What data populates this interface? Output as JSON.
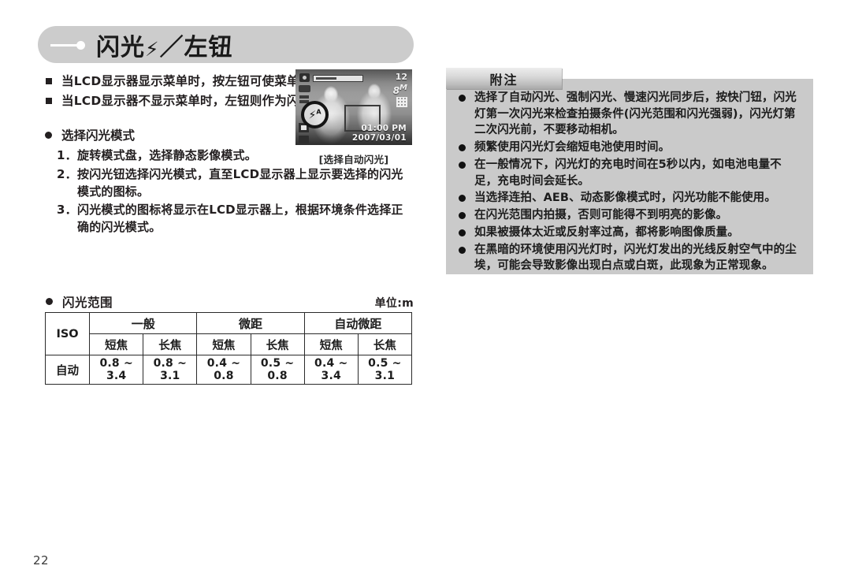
{
  "header": {
    "title_prefix": "闪光",
    "bolt_icon": "⚡",
    "title_suffix": "／左钮",
    "full_title": "闪光⚡ ／左钮"
  },
  "left_column": {
    "square_bullets": [
      "当LCD显示器显示菜单时，按左钮可使菜单光标左移。",
      "当LCD显示器不显示菜单时，左钮则作为闪光钮 ⚡ 使用。"
    ],
    "section_heading": "选择闪光模式",
    "steps": [
      {
        "num": "1．",
        "text": "旋转模式盘，选择静态影像模式。"
      },
      {
        "num": "2．",
        "text": "按闪光钮选择闪光模式，直至LCD显示器上显示要选择的闪光模式的图标。"
      },
      {
        "num": "3．",
        "text": "闪光模式的图标将显示在LCD显示器上，根据环境条件选择正确的闪光模式。"
      }
    ]
  },
  "lcd_figure": {
    "shots_remaining": "12",
    "resolution": "8",
    "resolution_suffix": "M",
    "time": "01:00 PM",
    "date": "2007/03/01",
    "flash_icon_label": "A",
    "caption": "[选择自动闪光]"
  },
  "notes": {
    "tab_label": "附注",
    "items": [
      "选择了自动闪光、强制闪光、慢速闪光同步后，按快门钮，闪光灯第一次闪光来检查拍摄条件(闪光范围和闪光强弱)，闪光灯第二次闪光前，不要移动相机。",
      "频繁使用闪光灯会缩短电池使用时间。",
      "在一般情况下，闪光灯的充电时间在5秒以内，如电池电量不足，充电时间会延长。",
      "当选择连拍、AEB、动态影像模式时，闪光功能不能使用。",
      "在闪光范围内拍摄，否则可能得不到明亮的影像。",
      "如果被摄体太近或反射率过高，都将影响图像质量。",
      "在黑暗的环境使用闪光灯时，闪光灯发出的光线反射空气中的尘埃，可能会导致影像出现白点或白斑，此现象为正常现象。"
    ]
  },
  "flash_range": {
    "heading": "闪光范围",
    "unit_label": "单位:m",
    "iso_label": "ISO",
    "groups": [
      "一般",
      "微距",
      "自动微距"
    ],
    "sub_headers": [
      "短焦",
      "长焦",
      "短焦",
      "长焦",
      "短焦",
      "长焦"
    ],
    "rows": [
      {
        "iso": "自动",
        "values": [
          "0.8 ~ 3.4",
          "0.8 ~ 3.1",
          "0.4 ~ 0.8",
          "0.5 ~ 0.8",
          "0.4 ~ 3.4",
          "0.5 ~ 3.1"
        ]
      }
    ]
  },
  "footer": {
    "page_number": "22"
  },
  "colors": {
    "banner_gray": "#cccccc",
    "panel_gray": "#cacaca",
    "text_dark": "#231f20"
  }
}
